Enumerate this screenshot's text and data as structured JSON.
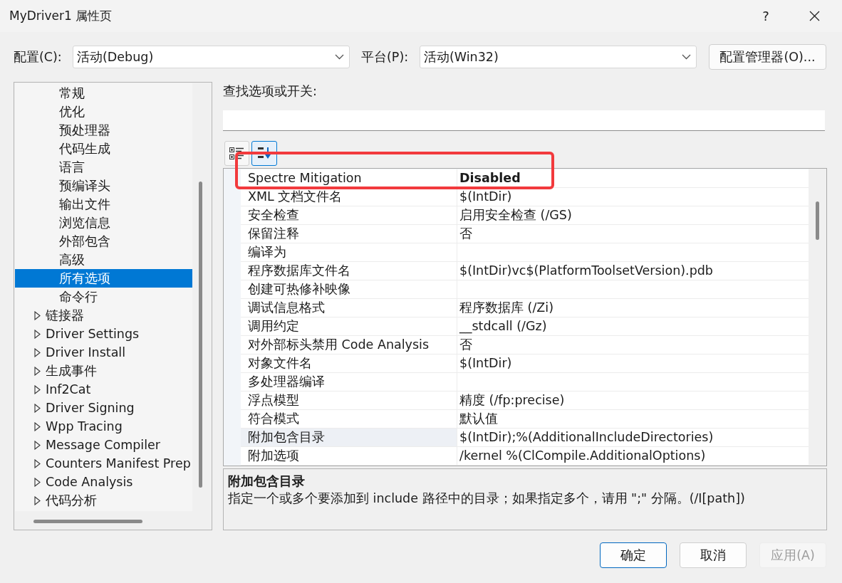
{
  "window": {
    "title": "MyDriver1 属性页",
    "help": "?"
  },
  "config_bar": {
    "configuration": {
      "label": "配置(C):",
      "value": "活动(Debug)"
    },
    "platform": {
      "label": "平台(P):",
      "value": "活动(Win32)"
    },
    "manager_button": "配置管理器(O)..."
  },
  "tree": [
    {
      "children": [
        {
          "label": "常规",
          "selected": false
        },
        {
          "label": "优化",
          "selected": false
        },
        {
          "label": "预处理器",
          "selected": false
        },
        {
          "label": "代码生成",
          "selected": false
        },
        {
          "label": "语言",
          "selected": false
        },
        {
          "label": "预编译头",
          "selected": false
        },
        {
          "label": "输出文件",
          "selected": false
        },
        {
          "label": "浏览信息",
          "selected": false
        },
        {
          "label": "外部包含",
          "selected": false
        },
        {
          "label": "高级",
          "selected": false
        },
        {
          "label": "所有选项",
          "selected": true
        },
        {
          "label": "命令行",
          "selected": false
        }
      ]
    },
    {
      "label": "链接器",
      "expanded": false,
      "selected": false
    },
    {
      "label": "Driver Settings",
      "expanded": false,
      "selected": false
    },
    {
      "label": "Driver Install",
      "expanded": false,
      "selected": false
    },
    {
      "label": "生成事件",
      "expanded": false,
      "selected": false
    },
    {
      "label": "Inf2Cat",
      "expanded": false,
      "selected": false
    },
    {
      "label": "Driver Signing",
      "expanded": false,
      "selected": false
    },
    {
      "label": "Wpp Tracing",
      "expanded": false,
      "selected": false
    },
    {
      "label": "Message Compiler",
      "expanded": false,
      "selected": false
    },
    {
      "label": "Counters Manifest Prep",
      "expanded": false,
      "selected": false
    },
    {
      "label": "Code Analysis",
      "expanded": false,
      "selected": false
    },
    {
      "label": "代码分析",
      "expanded": false,
      "selected": false
    }
  ],
  "search": {
    "label": "查找选项或开关:"
  },
  "view_buttons": [
    {
      "kind": "categorized",
      "selected": false
    },
    {
      "kind": "alphabetical",
      "selected": true
    }
  ],
  "properties": [
    {
      "name": "Spectre Mitigation",
      "value": "Disabled",
      "overridden": true,
      "selected": false,
      "highlighted": true
    },
    {
      "name": "XML 文档文件名",
      "value": "$(IntDir)",
      "overridden": false,
      "selected": false,
      "highlighted": false
    },
    {
      "name": "安全检查",
      "value": "启用安全检查 (/GS)",
      "overridden": false,
      "selected": false,
      "highlighted": false
    },
    {
      "name": "保留注释",
      "value": "否",
      "overridden": false,
      "selected": false,
      "highlighted": false
    },
    {
      "name": "编译为",
      "selected": false,
      "highlighted": false
    },
    {
      "name": "程序数据库文件名",
      "value": "$(IntDir)vc$(PlatformToolsetVersion).pdb",
      "overridden": false,
      "selected": false,
      "highlighted": false
    },
    {
      "name": "创建可热修补映像",
      "selected": false,
      "highlighted": false
    },
    {
      "name": "调试信息格式",
      "value": "程序数据库 (/Zi)",
      "overridden": false,
      "selected": false,
      "highlighted": false
    },
    {
      "name": "调用约定",
      "value": "__stdcall (/Gz)",
      "overridden": false,
      "selected": false,
      "highlighted": false
    },
    {
      "name": "对外部标头禁用 Code Analysis",
      "value": "否",
      "overridden": false,
      "selected": false,
      "highlighted": false
    },
    {
      "name": "对象文件名",
      "value": "$(IntDir)",
      "overridden": false,
      "selected": false,
      "highlighted": false
    },
    {
      "name": "多处理器编译",
      "selected": false,
      "highlighted": false
    },
    {
      "name": "浮点模型",
      "value": "精度 (/fp:precise)",
      "overridden": false,
      "selected": false,
      "highlighted": false
    },
    {
      "name": "符合模式",
      "value": "默认值",
      "overridden": false,
      "selected": false,
      "highlighted": false
    },
    {
      "name": "附加包含目录",
      "value": "$(IntDir);%(AdditionalIncludeDirectories)",
      "overridden": false,
      "selected": true,
      "highlighted": false
    },
    {
      "name": "附加选项",
      "value": "/kernel %(ClCompile.AdditionalOptions)",
      "overridden": false,
      "selected": false,
      "highlighted": false
    }
  ],
  "description": {
    "title": "附加包含目录",
    "text": "指定一个或多个要添加到 include 路径中的目录；如果指定多个，请用 \";\" 分隔。(/I[path])"
  },
  "buttons": [
    {
      "label": "确定",
      "default": true,
      "disabled": false
    },
    {
      "label": "取消",
      "default": false,
      "disabled": false
    },
    {
      "label": "应用(A)",
      "default": false,
      "disabled": true
    }
  ]
}
